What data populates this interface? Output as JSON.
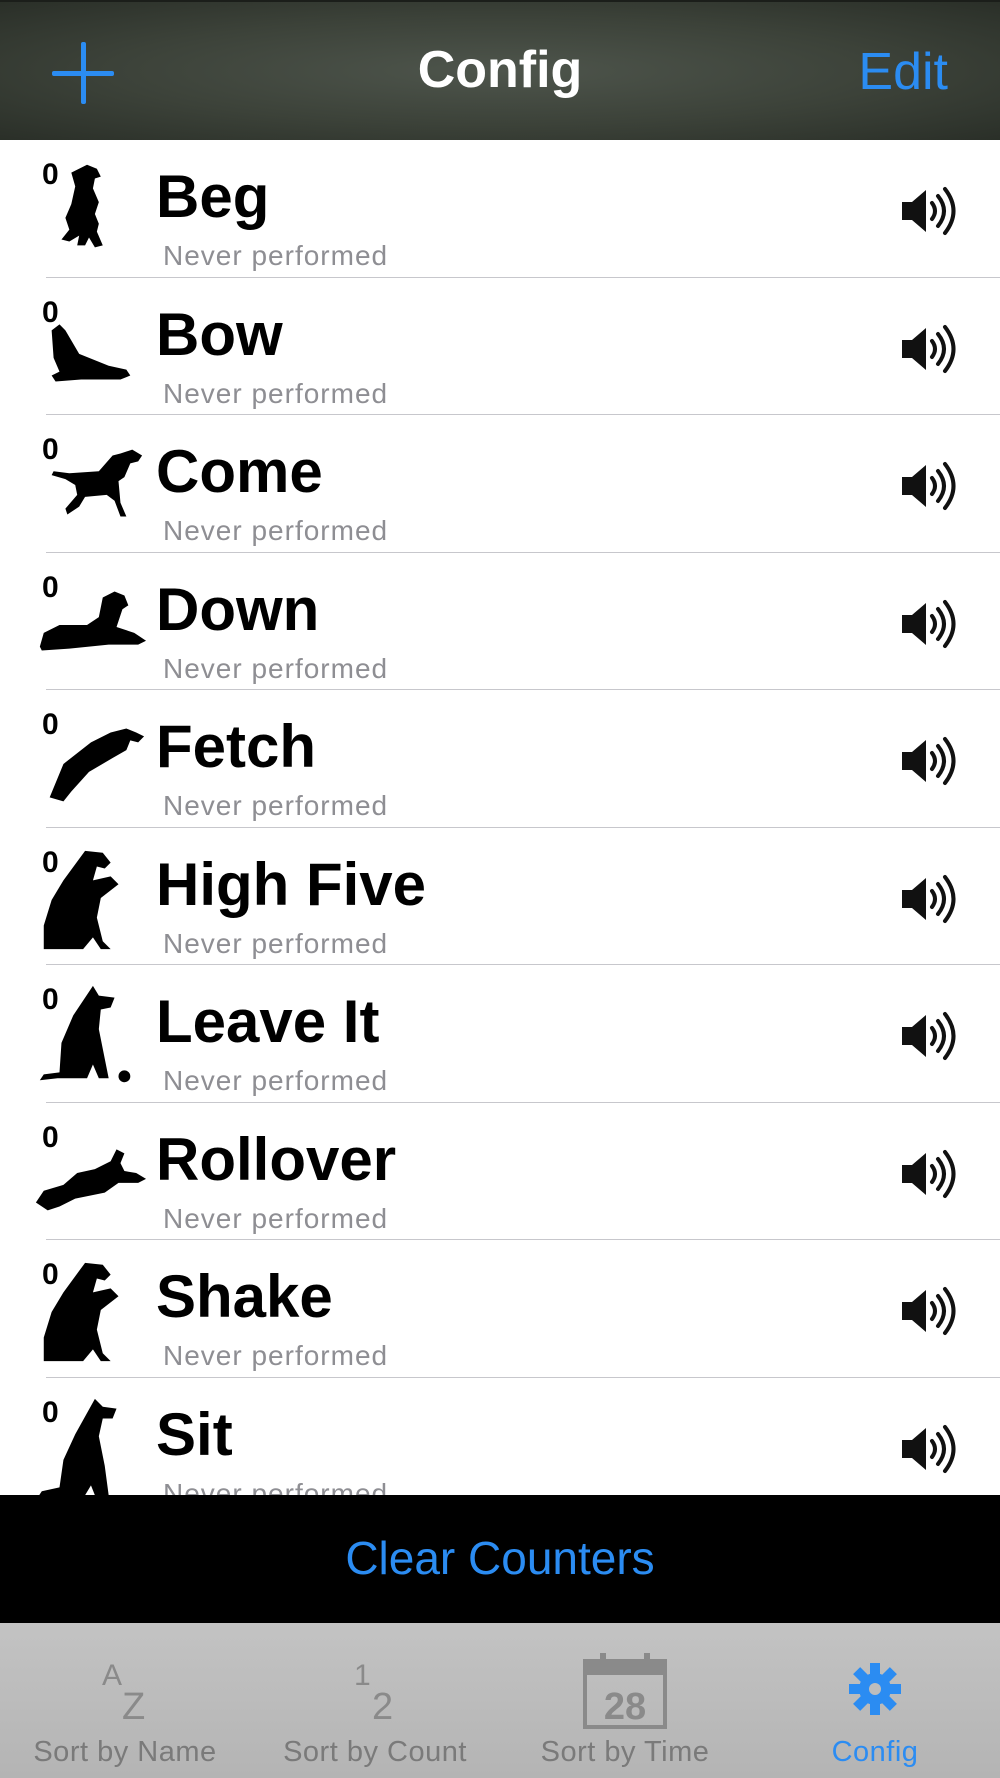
{
  "nav": {
    "add_icon": "plus-icon",
    "title": "Config",
    "edit_label": "Edit"
  },
  "tricks": [
    {
      "name": "Beg",
      "count": "0",
      "subtitle": "Never performed",
      "icon": "dog-begging-icon"
    },
    {
      "name": "Bow",
      "count": "0",
      "subtitle": "Never performed",
      "icon": "dog-bowing-icon"
    },
    {
      "name": "Come",
      "count": "0",
      "subtitle": "Never performed",
      "icon": "dog-walking-icon"
    },
    {
      "name": "Down",
      "count": "0",
      "subtitle": "Never performed",
      "icon": "dog-lying-icon"
    },
    {
      "name": "Fetch",
      "count": "0",
      "subtitle": "Never performed",
      "icon": "dog-jumping-icon"
    },
    {
      "name": "High Five",
      "count": "0",
      "subtitle": "Never performed",
      "icon": "dog-paw-up-icon"
    },
    {
      "name": "Leave It",
      "count": "0",
      "subtitle": "Never performed",
      "icon": "dog-sitting-ball-icon"
    },
    {
      "name": "Rollover",
      "count": "0",
      "subtitle": "Never performed",
      "icon": "dog-rolling-icon"
    },
    {
      "name": "Shake",
      "count": "0",
      "subtitle": "Never performed",
      "icon": "dog-paw-up-icon"
    },
    {
      "name": "Sit",
      "count": "0",
      "subtitle": "Never performed",
      "icon": "dog-sitting-icon"
    }
  ],
  "footer": {
    "clear_label": "Clear Counters"
  },
  "tabs": [
    {
      "label": "Sort by Name",
      "icon": "sort-az-icon",
      "active": false
    },
    {
      "label": "Sort by Count",
      "icon": "sort-12-icon",
      "active": false
    },
    {
      "label": "Sort by Time",
      "icon": "calendar-28-icon",
      "active": false,
      "icon_text": "28"
    },
    {
      "label": "Config",
      "icon": "gear-icon",
      "active": true
    }
  ],
  "colors": {
    "accent": "#2b8cf2",
    "nav_bg": "#3c4239",
    "tab_inactive": "#7a7a7a"
  }
}
